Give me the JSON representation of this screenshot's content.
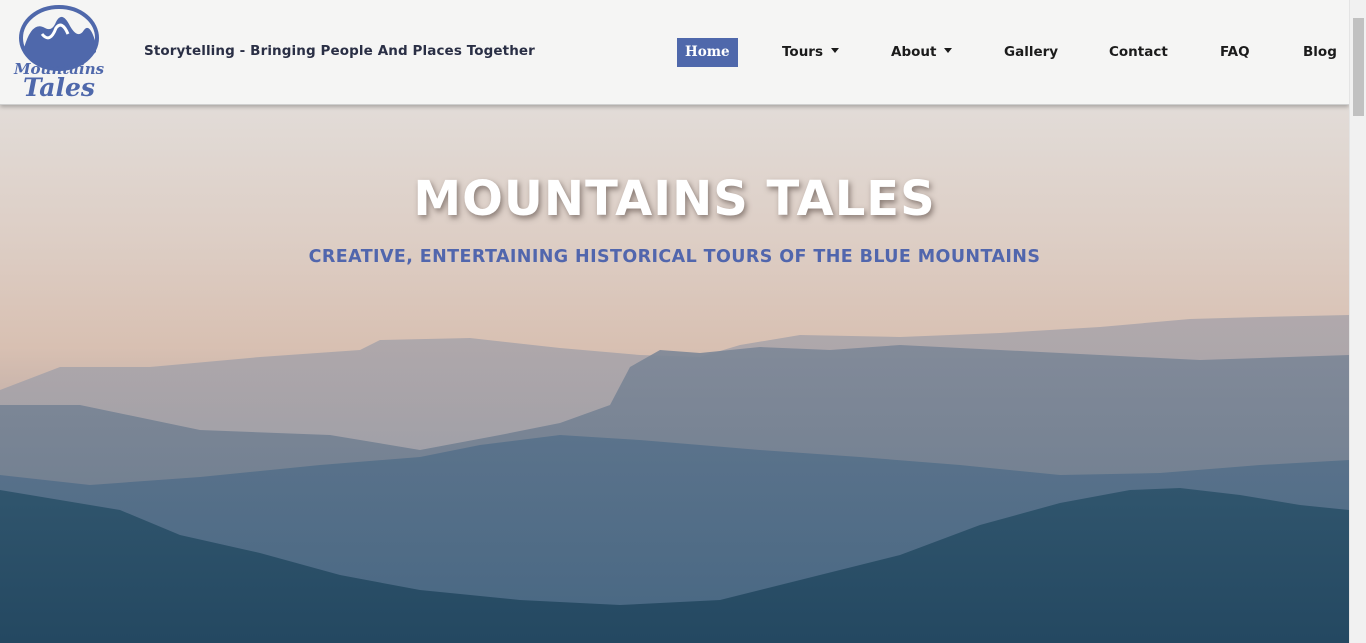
{
  "brand": {
    "logo_line1": "Mountains",
    "logo_line2": "Tales",
    "tagline": "Storytelling - Bringing People And Places Together"
  },
  "nav": {
    "items": [
      {
        "label": "Home",
        "active": true,
        "dropdown": false
      },
      {
        "label": "Tours",
        "active": false,
        "dropdown": true
      },
      {
        "label": "About",
        "active": false,
        "dropdown": true
      },
      {
        "label": "Gallery",
        "active": false,
        "dropdown": false
      },
      {
        "label": "Contact",
        "active": false,
        "dropdown": false
      },
      {
        "label": "FAQ",
        "active": false,
        "dropdown": false
      },
      {
        "label": "Blog",
        "active": false,
        "dropdown": false
      }
    ]
  },
  "hero": {
    "title": "MOUNTAINS TALES",
    "subtitle": "CREATIVE, ENTERTAINING HISTORICAL TOURS OF THE BLUE MOUNTAINS"
  },
  "colors": {
    "accent": "#4f68ab",
    "subtitle": "#5166ad",
    "header_bg": "#f5f5f4",
    "nav_text": "#1b1b1b"
  },
  "icons": {
    "logo": "mountain-logo-icon",
    "dropdown": "caret-down-icon"
  }
}
